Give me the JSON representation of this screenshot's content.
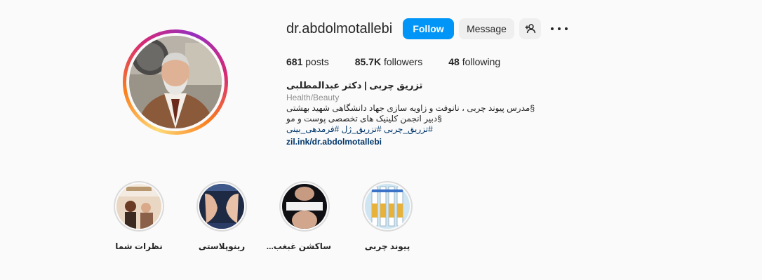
{
  "profile": {
    "username": "dr.abdolmotallebi",
    "follow_label": "Follow",
    "message_label": "Message",
    "stats": {
      "posts": "681",
      "posts_label": "posts",
      "followers": "85.7K",
      "followers_label": "followers",
      "following": "48",
      "following_label": "following"
    },
    "bio": {
      "full_name": "تزریق چربی | دکتر عبدالمطلبی",
      "category": "Health/Beauty",
      "line1": "§مدرس پیوند چربی ، نانوفت و زاویه سازی جهاد دانشگاهی شهید بهشتی",
      "line2": "§دبیر انجمن کلینیک های تخصصی پوست و مو",
      "tags": "#تزریق_چربی #تزریق_ژل #فرمدهی_بینی",
      "link": "zil.ink/dr.abdolmotallebi"
    }
  },
  "highlights": [
    {
      "label": "نظرات شما"
    },
    {
      "label": "رینوپلاستی"
    },
    {
      "label": "ساکشن غبغب..."
    },
    {
      "label": "پیوند چربی"
    }
  ],
  "colors": {
    "accent": "#0095f6",
    "link": "#00376b",
    "muted": "#8e8e8e",
    "button_bg": "#efefef"
  },
  "icons": {
    "add_user": "add-user-icon",
    "more": "more-options-icon"
  }
}
